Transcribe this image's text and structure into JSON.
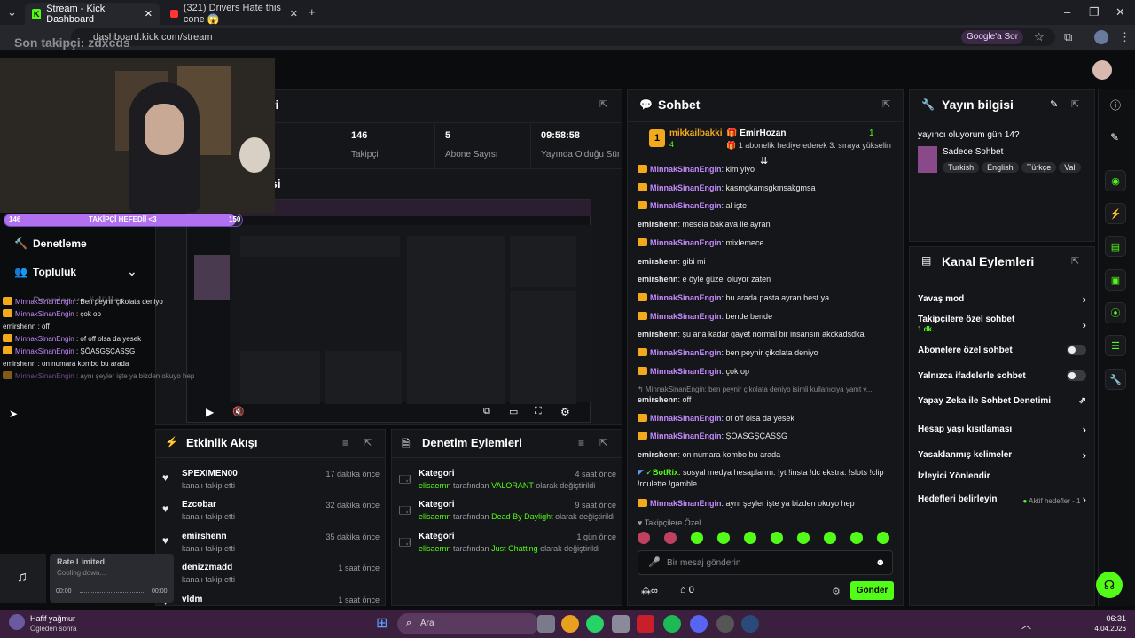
{
  "browser": {
    "tabs": [
      {
        "title": "Stream - Kick Dashboard"
      },
      {
        "title": "(321) Drivers Hate this cone 😱"
      }
    ],
    "url": "dashboard.kick.com/stream",
    "google_btn": "Google'a Sor"
  },
  "overlay": {
    "last_follower": "Son takipçi: zdxcds",
    "goal_left": "146",
    "goal_label": "TAKİPÇİ HEFEDİİ <3",
    "goal_right": "150",
    "goal_progress": 0.973,
    "chat": [
      {
        "user": "MinnakSinanEngin",
        "msg": " : Ben peynir çikolata deniyo"
      },
      {
        "user": "MinnakSinanEngin",
        "msg": " : çok op"
      },
      {
        "user": "emirshenn",
        "msg": " : off"
      },
      {
        "user": "MinnakSinanEngin",
        "msg": " : of off olsa da yesek"
      },
      {
        "user": "MinnakSinanEngin",
        "msg": " : ŞÖASGŞÇASŞG"
      },
      {
        "user": "emirshenn",
        "msg": " : on numara kombo bu arada"
      },
      {
        "user": "MinnakSinanEngin",
        "msg": " : aynı şeyler işte ya bizden okuyo hep"
      }
    ]
  },
  "sidebar": {
    "items": [
      {
        "label": "Denetleme"
      },
      {
        "label": "Topluluk"
      },
      {
        "label": "Dropler ve ödüller"
      }
    ]
  },
  "stats": [
    {
      "value": "146",
      "label": "Takipçi"
    },
    {
      "value": "5",
      "label": "Abone Sayısı"
    },
    {
      "value": "09:58:58",
      "label": "Yayında Olduğu Süre"
    }
  ],
  "panels": {
    "stats_title": "ri",
    "preview_title": "si"
  },
  "activity": {
    "title": "Etkinlik Akışı",
    "items": [
      {
        "name": "SPEXIMEN00",
        "sub": "kanalı takip etti",
        "time": "17 dakika önce"
      },
      {
        "name": "Ezcobar",
        "sub": "kanalı takip etti",
        "time": "32 dakika önce"
      },
      {
        "name": "emirshenn",
        "sub": "kanalı takip etti",
        "time": "35 dakika önce"
      },
      {
        "name": "denizzmadd",
        "sub": "kanalı takip etti",
        "time": "1 saat önce"
      },
      {
        "name": "vldm",
        "sub": "",
        "time": "1 saat önce"
      }
    ]
  },
  "moderation": {
    "title": "Denetim Eylemleri",
    "items": [
      {
        "name": "Kategori",
        "actor": "elisaernn",
        "mid": " tarafından ",
        "value": "VALORANT",
        "end": " olarak değiştirildi",
        "time": "4 saat önce"
      },
      {
        "name": "Kategori",
        "actor": "elisaernn",
        "mid": " tarafından ",
        "value": "Dead By Daylight",
        "end": " olarak değiştirildi",
        "time": "9 saat önce"
      },
      {
        "name": "Kategori",
        "actor": "elisaernn",
        "mid": " tarafından ",
        "value": "Just Chatting",
        "end": " olarak değiştirildi",
        "time": "1 gün önce"
      }
    ]
  },
  "chat": {
    "title": "Sohbet",
    "pinned_user": "mikkailbakki",
    "pinned_count": "4",
    "gifter": "EmirHozan",
    "gifter_count": "1",
    "gift_text": "1 abonelik hediye ederek 3. sıraya yükselin",
    "messages": [
      {
        "user": "MinnakSinanEngin",
        "text": ": kim yiyo",
        "badge": true
      },
      {
        "user": "MinnakSinanEngin",
        "text": ": kasmgkamsgkmsakgmsa",
        "badge": true
      },
      {
        "user": "MinnakSinanEngin",
        "text": ": al işte",
        "badge": true
      },
      {
        "user": "emirshenn",
        "text": ": mesela baklava ile ayran",
        "badge": false
      },
      {
        "user": "MinnakSinanEngin",
        "text": ": mixlemece",
        "badge": true
      },
      {
        "user": "emirshenn",
        "text": ": gibi mi",
        "badge": false
      },
      {
        "user": "emirshenn",
        "text": ": e öyle güzel oluyor zaten",
        "badge": false
      },
      {
        "user": "MinnakSinanEngin",
        "text": ": bu arada pasta ayran best ya",
        "badge": true
      },
      {
        "user": "MinnakSinanEngin",
        "text": ": bende bende",
        "badge": true
      },
      {
        "user": "emirshenn",
        "text": ": şu ana kadar gayet normal bir insansın akckadsdka",
        "badge": false
      },
      {
        "user": "MinnakSinanEngin",
        "text": ": ben peynir çikolata deniyo",
        "badge": true
      },
      {
        "user": "MinnakSinanEngin",
        "text": ": çok op",
        "badge": true
      }
    ],
    "reply_hint": "↰ MinnakSinanEngin: ben peynir çikolata deniyo isimli kullanıcıya yanıt v...",
    "messages2": [
      {
        "user": "emirshenn",
        "text": ": off",
        "badge": false
      },
      {
        "user": "MinnakSinanEngin",
        "text": ": of off olsa da yesek",
        "badge": true
      },
      {
        "user": "MinnakSinanEngin",
        "text": ": ŞÖASGŞÇASŞG",
        "badge": true
      },
      {
        "user": "emirshenn",
        "text": ": on numara kombo bu arada",
        "badge": false
      }
    ],
    "bot_user": "BotRix",
    "bot_text": ": sosyal medya hesaplarım: !yt !insta !dc ekstra: !slots !clip !roulette !gamble",
    "last_user": "MinnakSinanEngin",
    "last_text": ": aynı şeyler işte ya bizden okuyo hep",
    "mode_label": "Takipçilere Özel",
    "input_placeholder": "Bir mesaj gönderin",
    "infinite": "∞",
    "points": "0",
    "send_label": "Gönder"
  },
  "stream_info": {
    "title": "Yayın bilgisi",
    "stream_title": "yayıncı oluyorum gün 14?",
    "category": "Sadece Sohbet",
    "tags": [
      "Turkish",
      "English",
      "Türkçe",
      "Val"
    ]
  },
  "channel_actions": {
    "title": "Kanal Eylemleri",
    "slow_mode": "Yavaş mod",
    "followers_only": "Takipçilere özel sohbet",
    "followers_only_sub": "1 dk.",
    "subs_only": "Abonelere özel sohbet",
    "emotes_only": "Yalnızca ifadelerle sohbet",
    "ai_moderation": "Yapay Zeka ile Sohbet Denetimi",
    "age_limits": "Hesap yaşı kısıtlaması",
    "banned_words": "Yasaklanmış kelimeler",
    "redirect": "İzleyici Yönlendir",
    "goals": "Hedefleri belirleyin",
    "goals_status": "Aktif hedefler - 1"
  },
  "music": {
    "title": "Rate Limited",
    "sub": "Cooling down...",
    "t1": "00:00",
    "t2": "00:00"
  },
  "taskbar": {
    "weather": "Hafif yağmur",
    "weather_sub": "Öğleden sonra",
    "search": "Ara",
    "time": "06:31",
    "date": "4.04.2026"
  }
}
